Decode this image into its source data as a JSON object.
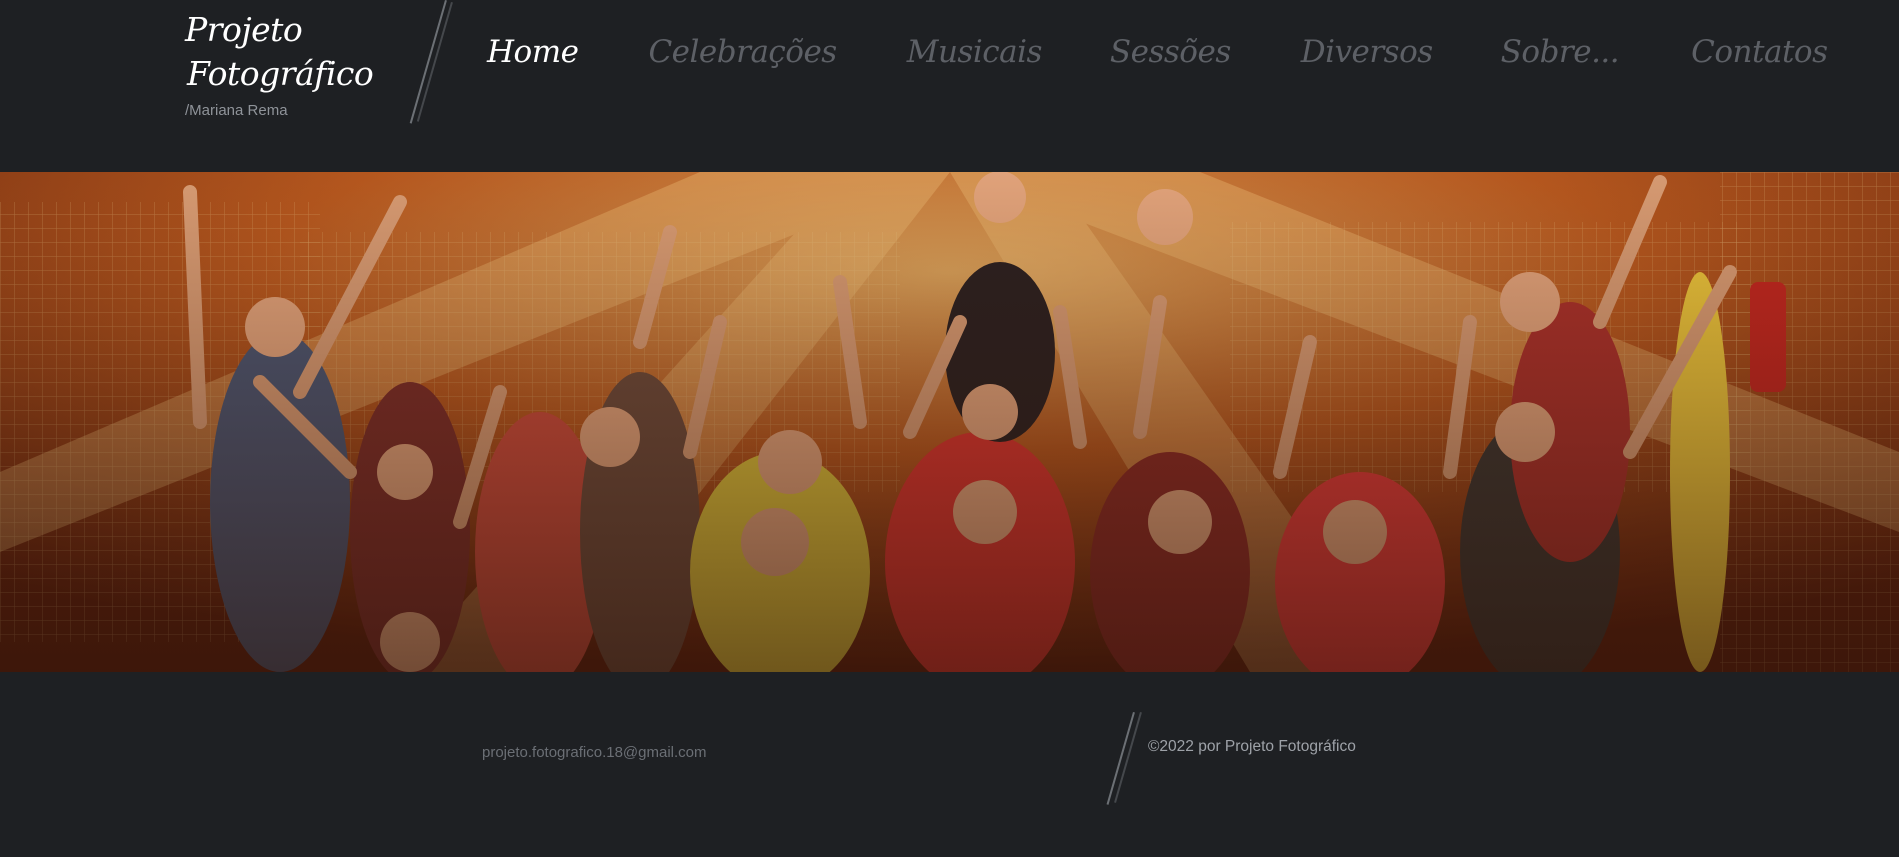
{
  "site": {
    "title_line1": "Projeto",
    "title_line2": "Fotográfico",
    "subtitle": "/Mariana Rema"
  },
  "nav": {
    "items": [
      {
        "label": "Home",
        "active": true
      },
      {
        "label": "Celebrações",
        "active": false
      },
      {
        "label": "Musicais",
        "active": false
      },
      {
        "label": "Sessões",
        "active": false
      },
      {
        "label": "Diversos",
        "active": false
      },
      {
        "label": "Sobre...",
        "active": false
      },
      {
        "label": "Contatos",
        "active": false
      }
    ]
  },
  "hero": {
    "image": "group-photo-children-costumes"
  },
  "footer": {
    "email": "projeto.fotografico.18@gmail.com",
    "copyright": "©2022 por Projeto Fotográfico"
  },
  "colors": {
    "background": "#1e2023",
    "nav_active": "#ffffff",
    "nav_inactive": "#5d6066",
    "footer_text": "#6b6f75"
  }
}
